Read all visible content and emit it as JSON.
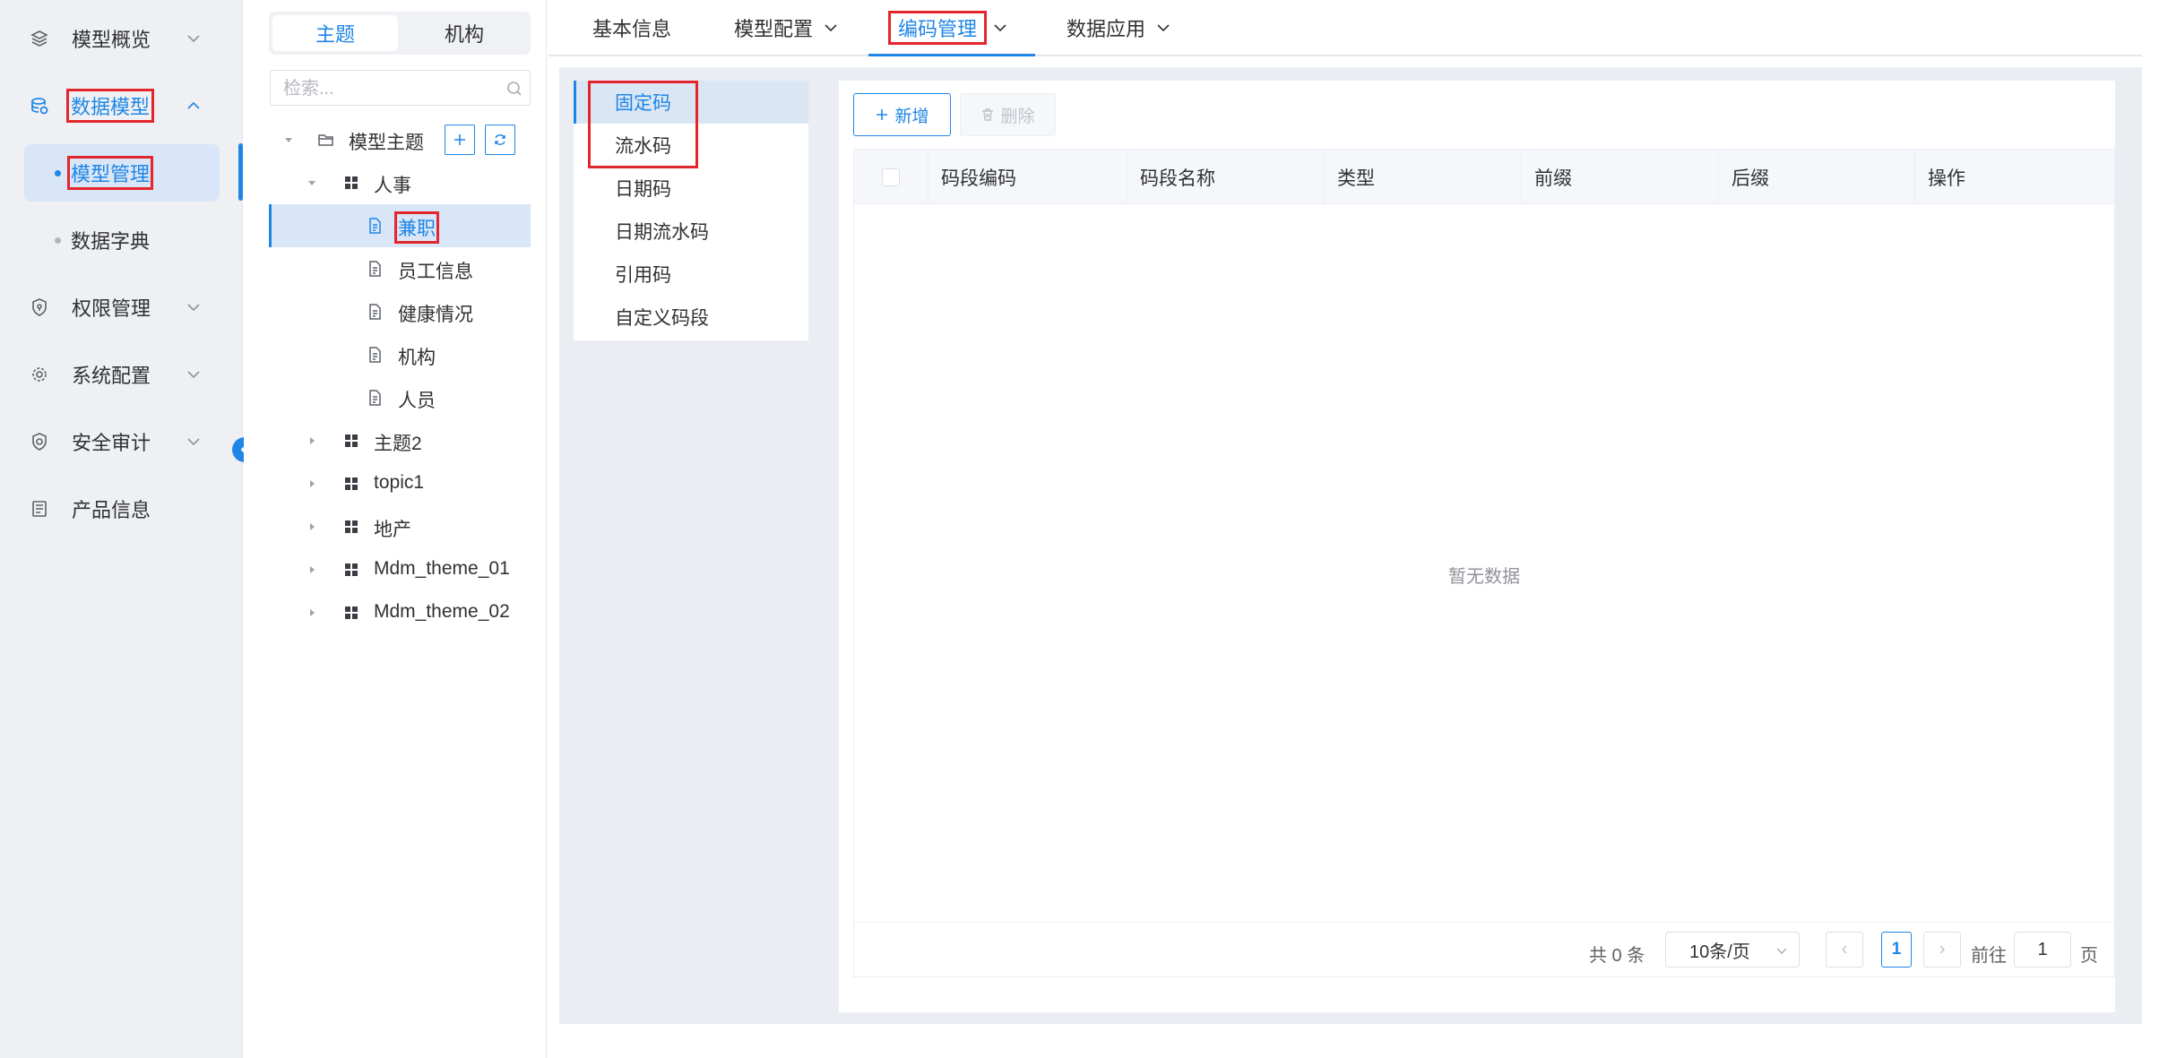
{
  "nav": {
    "overview": "模型概览",
    "data_model": "数据模型",
    "model_manage": "模型管理",
    "data_dict": "数据字典",
    "permission": "权限管理",
    "sys_config": "系统配置",
    "security_audit": "安全审计",
    "product_info": "产品信息"
  },
  "tree": {
    "tabs": [
      "主题",
      "机构"
    ],
    "search_placeholder": "检索...",
    "root": "模型主题",
    "nodes": {
      "renshi": "人事",
      "jianzhi": "兼职",
      "staff": "员工信息",
      "health": "健康情况",
      "org": "机构",
      "person": "人员",
      "theme2": "主题2",
      "topic1": "topic1",
      "estate": "地产",
      "mdm1": "Mdm_theme_01",
      "mdm2": "Mdm_theme_02"
    }
  },
  "top_tabs": {
    "basic": "基本信息",
    "model_config": "模型配置",
    "code_manage": "编码管理",
    "data_app": "数据应用"
  },
  "code_types": [
    "固定码",
    "流水码",
    "日期码",
    "日期流水码",
    "引用码",
    "自定义码段"
  ],
  "toolbar": {
    "add": "新增",
    "delete": "删除"
  },
  "table": {
    "columns": [
      "码段编码",
      "码段名称",
      "类型",
      "前缀",
      "后缀",
      "操作"
    ],
    "rows": [],
    "empty": "暂无数据"
  },
  "pagination": {
    "total": "共 0 条",
    "page_size": "10条/页",
    "current": "1",
    "goto_prefix": "前往",
    "goto_value": "1",
    "goto_suffix": "页"
  },
  "colors": {
    "accent": "#1f86e6",
    "highlight_box": "#e3262c",
    "nav_bg": "#eef0f4"
  }
}
